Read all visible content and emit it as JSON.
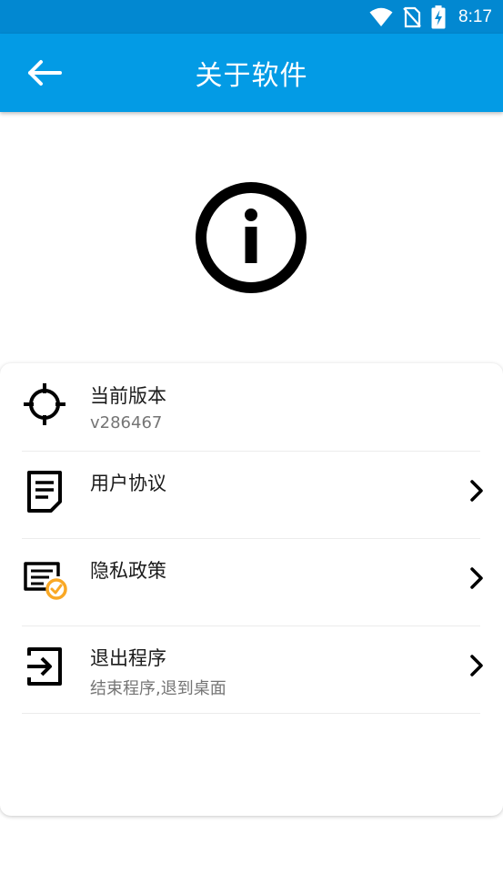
{
  "status": {
    "time": "8:17",
    "icons": [
      "wifi-icon",
      "no-sim-icon",
      "battery-charging-icon"
    ]
  },
  "header": {
    "title": "关于软件",
    "back_icon": "arrow-left-icon"
  },
  "hero": {
    "icon": "info-circle-icon"
  },
  "list": {
    "items": [
      {
        "label": "当前版本",
        "sub": "v286467",
        "icon": "crosshair-icon",
        "chevron": false
      },
      {
        "label": "用户协议",
        "sub": "",
        "icon": "document-icon",
        "chevron": true
      },
      {
        "label": "隐私政策",
        "sub": "",
        "icon": "policy-check-icon",
        "chevron": true
      },
      {
        "label": "退出程序",
        "sub": "结束程序,退到桌面",
        "icon": "exit-icon",
        "chevron": true
      }
    ]
  },
  "colors": {
    "status_bar": "#0288d1",
    "app_bar": "#039be5",
    "policy_accent": "#f9a825"
  }
}
